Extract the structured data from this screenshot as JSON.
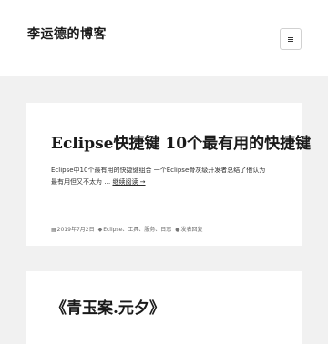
{
  "site": {
    "title": "李运德的博客"
  },
  "posts": [
    {
      "title": "Eclipse快捷键 10个最有用的快捷键",
      "excerpt_line1": "Eclipse中10个最有用的快捷键组合 一个Eclipse骨灰级开发者总结了他认为",
      "excerpt_line2": "最有用但又不太为 … ",
      "more_link": "继续阅读 →",
      "date": "2019年7月2日",
      "tags": "Eclipse、工具、服务、日志",
      "comment_link": "发表回复"
    },
    {
      "title": "《青玉案.元夕》"
    }
  ],
  "icons": {
    "menu": "hamburger-menu",
    "date": "calendar-icon",
    "tags": "tag-icon",
    "comments": "comment-icon"
  }
}
